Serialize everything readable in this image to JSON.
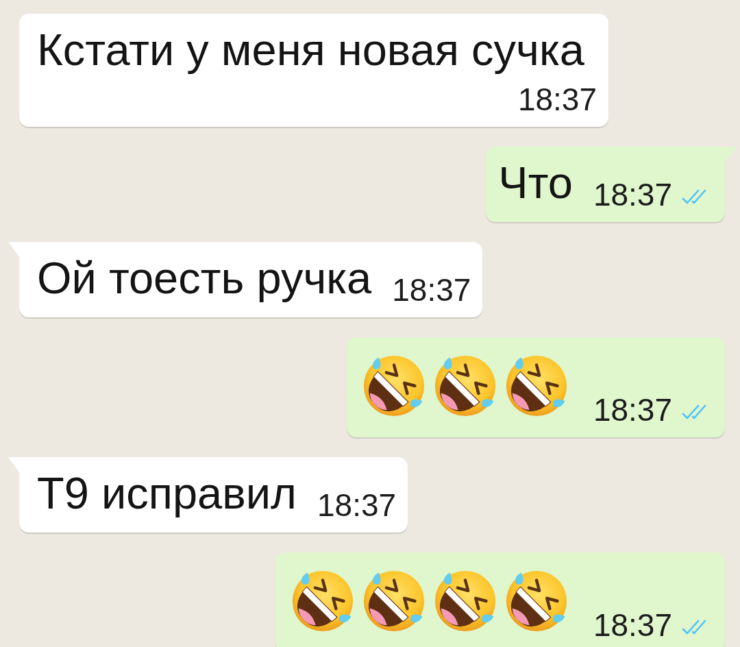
{
  "messages": [
    {
      "outgoing": false,
      "tail": false,
      "kind": "text",
      "text": "Кстати у меня новая сучка",
      "time": "18:37"
    },
    {
      "outgoing": true,
      "tail": true,
      "kind": "text",
      "text": "Что",
      "time": "18:37",
      "read": true
    },
    {
      "outgoing": false,
      "tail": true,
      "kind": "text",
      "text": "Ой тоесть ручка",
      "time": "18:37"
    },
    {
      "outgoing": true,
      "tail": false,
      "kind": "emoji",
      "emojis": [
        {
          "kind": "rofl"
        },
        {
          "kind": "rofl"
        },
        {
          "kind": "rofl"
        }
      ],
      "time": "18:37",
      "read": true
    },
    {
      "outgoing": false,
      "tail": true,
      "kind": "text",
      "text": "T9 исправил",
      "time": "18:37"
    },
    {
      "outgoing": true,
      "tail": false,
      "kind": "emoji",
      "emojis": [
        {
          "kind": "rofl"
        },
        {
          "kind": "rofl"
        },
        {
          "kind": "rofl"
        },
        {
          "kind": "rofl"
        }
      ],
      "time": "18:37",
      "read": true
    }
  ]
}
